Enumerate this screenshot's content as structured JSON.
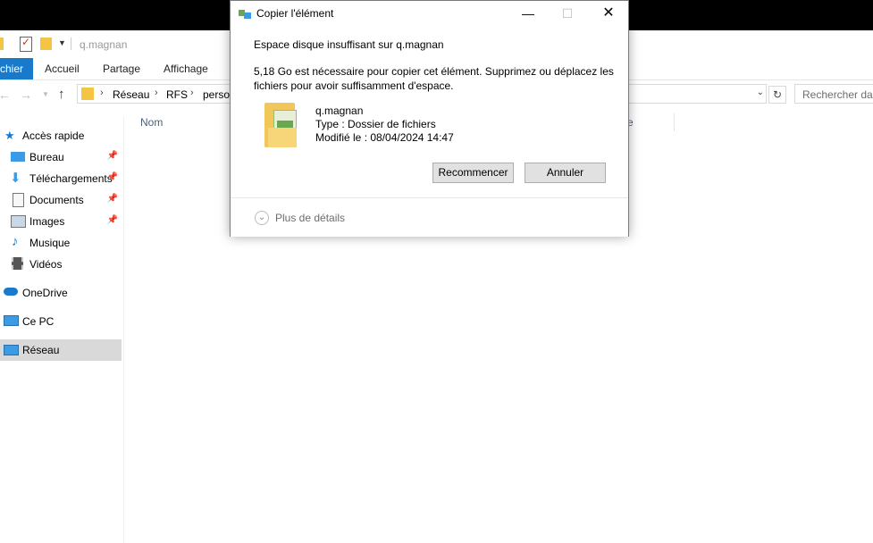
{
  "qat": {
    "path_hint": "q.magnan"
  },
  "ribbon": {
    "tabs": [
      "chier",
      "Accueil",
      "Partage",
      "Affichage"
    ]
  },
  "address": {
    "crumbs": [
      "Réseau",
      "RFS",
      "perso"
    ],
    "search_placeholder": "Rechercher dan"
  },
  "nav": {
    "items": [
      {
        "label": "Accès rapide"
      },
      {
        "label": "Bureau"
      },
      {
        "label": "Téléchargements"
      },
      {
        "label": "Documents"
      },
      {
        "label": "Images"
      },
      {
        "label": "Musique"
      },
      {
        "label": "Vidéos"
      },
      {
        "label": "OneDrive"
      },
      {
        "label": "Ce PC"
      },
      {
        "label": "Réseau"
      }
    ]
  },
  "content": {
    "col_name": "Nom",
    "col_other_partial": "e"
  },
  "dialog": {
    "title": "Copier l'élément",
    "heading": "Espace disque insuffisant sur q.magnan",
    "message_line1": "5,18 Go est nécessaire pour copier cet élément. Supprimez ou déplacez les",
    "message_line2": "fichiers pour avoir suffisamment d'espace.",
    "item_name": "q.magnan",
    "item_type": "Type : Dossier de fichiers",
    "item_modified": "Modifié le : 08/04/2024 14:47",
    "retry_label": "Recommencer",
    "cancel_label": "Annuler",
    "more_details": "Plus de détails"
  },
  "colors": {
    "accent": "#1979ca",
    "selected_bg": "#d9d9d9"
  }
}
